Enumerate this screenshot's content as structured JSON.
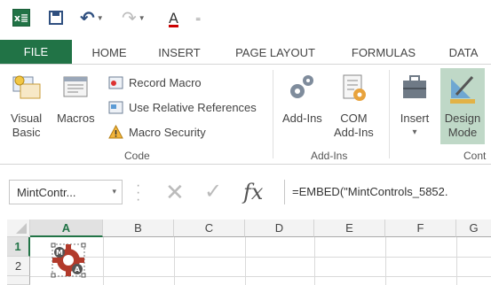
{
  "qat": {
    "app_icon_text": "x≣",
    "font_color_letter": "A",
    "icons": [
      "excel-logo-icon",
      "save-icon",
      "undo-icon",
      "redo-icon",
      "font-color-icon",
      "customize-qat-icon"
    ]
  },
  "tabs": [
    {
      "label": "FILE"
    },
    {
      "label": "HOME"
    },
    {
      "label": "INSERT"
    },
    {
      "label": "PAGE LAYOUT"
    },
    {
      "label": "FORMULAS"
    },
    {
      "label": "DATA"
    }
  ],
  "ribbon": {
    "code": {
      "label": "Code",
      "visual_basic": {
        "line1": "Visual",
        "line2": "Basic"
      },
      "macros": "Macros",
      "record_macro": "Record Macro",
      "use_relative": "Use Relative References",
      "macro_security": "Macro Security"
    },
    "addins": {
      "label": "Add-Ins",
      "addins_btn": "Add-Ins",
      "com_line1": "COM",
      "com_line2": "Add-Ins"
    },
    "controls": {
      "label": "Cont",
      "insert": "Insert",
      "insert_caret": "▾",
      "design_line1": "Design",
      "design_line2": "Mode"
    }
  },
  "formula_bar": {
    "name_box": "MintContr...",
    "name_box_caret": "▾",
    "cancel": "✕",
    "enter": "✓",
    "fx": "fx",
    "formula": "=EMBED(\"MintControls_5852."
  },
  "grid": {
    "columns": [
      "A",
      "B",
      "C",
      "D",
      "E",
      "F",
      "G"
    ],
    "rows": [
      "1",
      "2"
    ],
    "active_column": "A",
    "active_row": "1",
    "embedded_control": {
      "letters": [
        "M",
        "A"
      ]
    }
  },
  "colors": {
    "excel_green": "#217346",
    "design_mode_highlight": "#bfd8c7"
  }
}
